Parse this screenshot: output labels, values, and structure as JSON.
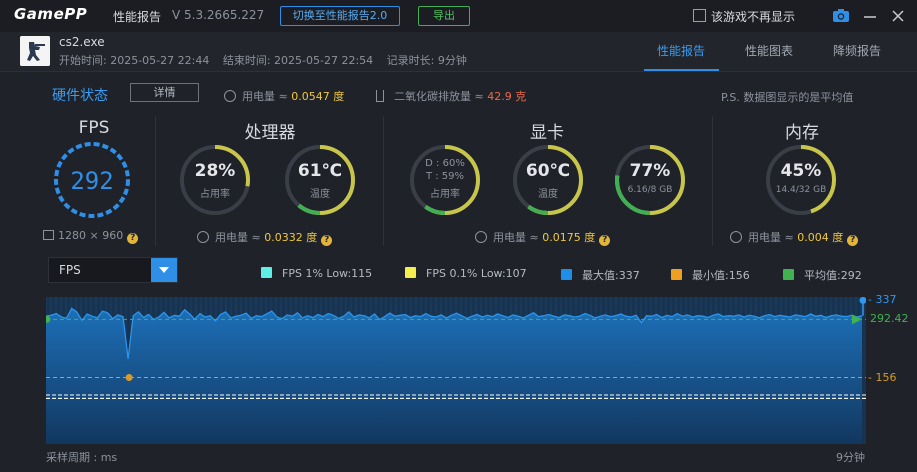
{
  "titlebar": {
    "logo": "GamePP",
    "title": "性能报告",
    "version": "V 5.3.2665.227",
    "switch_label": "切换至性能报告2.0",
    "export_label": "导出",
    "dont_show_label": "该游戏不再显示"
  },
  "header": {
    "game_name": "cs2.exe",
    "start_time": "开始时间: 2025-05-27 22:44",
    "end_time": "结束时间: 2025-05-27 22:54",
    "duration": "记录时长: 9分钟",
    "tabs": [
      {
        "label": "性能报告",
        "active": true
      },
      {
        "label": "性能图表",
        "active": false
      },
      {
        "label": "降频报告",
        "active": false
      }
    ]
  },
  "hardware": {
    "title": "硬件状态",
    "detail_label": "详情",
    "power_prefix": "用电量 ≈ ",
    "power_total": "0.0547 度",
    "co2_prefix": "二氧化碳排放量 ≈ ",
    "co2_value": "42.9 克",
    "ps_note": "P.S. 数据图显示的是平均值"
  },
  "sections": {
    "fps": {
      "title": "FPS",
      "value": "292",
      "resolution": "1280 × 960"
    },
    "cpu": {
      "title": "处理器",
      "usage": {
        "value": "28%",
        "label": "占用率",
        "fraction": 0.28
      },
      "temp": {
        "value": "61℃",
        "label": "温度",
        "fraction": 0.61
      },
      "power": "0.0332 度"
    },
    "gpu": {
      "title": "显卡",
      "usage": {
        "d": "D : 60%",
        "t": "T : 59%",
        "label": "占用率",
        "fraction": 0.6
      },
      "temp": {
        "value": "60℃",
        "label": "温度",
        "fraction": 0.6
      },
      "vram": {
        "value": "77%",
        "label": "6.16/8 GB",
        "fraction": 0.77
      },
      "power": "0.0175 度"
    },
    "memory": {
      "title": "内存",
      "usage": {
        "value": "45%",
        "label": "14.4/32 GB",
        "fraction": 0.45
      },
      "power": "0.004 度"
    }
  },
  "chart_controls": {
    "metric": "FPS",
    "legend": [
      {
        "label": "FPS 1% Low:115",
        "color": "#5ef0e6"
      },
      {
        "label": "FPS 0.1% Low:107",
        "color": "#f3ee4e"
      },
      {
        "label": "最大值:337",
        "color": "#1e8fe8"
      },
      {
        "label": "最小值:156",
        "color": "#f0a020"
      },
      {
        "label": "平均值:292",
        "color": "#3fb34f"
      }
    ],
    "x_left_label": "采样周期 : ms",
    "x_right_label": "9分钟"
  },
  "chart_data": {
    "type": "area",
    "series": [
      {
        "name": "FPS",
        "values": [
          300,
          302,
          306,
          298,
          295,
          318,
          310,
          290,
          305,
          300,
          296,
          312,
          308,
          294,
          303,
          299,
          200,
          301,
          310,
          297,
          304,
          292,
          298,
          309,
          296,
          302,
          300,
          315,
          305,
          293,
          306,
          298,
          301,
          289,
          304,
          310,
          296,
          300,
          302,
          307,
          295,
          301,
          299,
          305,
          312,
          298,
          294,
          303,
          300,
          308,
          296,
          301,
          297,
          304,
          299,
          306,
          302,
          295,
          300,
          310,
          298,
          303,
          301,
          296,
          305,
          292,
          299,
          307,
          300,
          302,
          304,
          297,
          301,
          299,
          306,
          300,
          298,
          303,
          296,
          302,
          307,
          301,
          295,
          300,
          304,
          298,
          302,
          299,
          305,
          301,
          297,
          303,
          300,
          296,
          302,
          308,
          299,
          301,
          304,
          300,
          297,
          303,
          301,
          298,
          300,
          306,
          302,
          296,
          300,
          303,
          299,
          301,
          305,
          300,
          298,
          302,
          285,
          301,
          300,
          304,
          297,
          302,
          299,
          306,
          300,
          303,
          298,
          301,
          300,
          297,
          302,
          305,
          299,
          301,
          300,
          303,
          298,
          302,
          300,
          296,
          301,
          304,
          299,
          302,
          300,
          298,
          303,
          301,
          299,
          305,
          300,
          302,
          297,
          301,
          303,
          300,
          299,
          302,
          298,
          301
        ]
      }
    ],
    "ylim": [
      0,
      345
    ],
    "reference_lines": {
      "max": 337,
      "min": 156,
      "avg": 292.42,
      "low_1pct": 115,
      "low_01pct": 107
    },
    "ref_labels": {
      "max": "337",
      "avg": "292.42",
      "min": "156"
    },
    "colors": {
      "fill_top": "#1d6fb8",
      "fill_bottom": "#12375f",
      "line": "#2896f0",
      "avg": "#3fb34f",
      "min": "#d79a28",
      "max": "#2e97f0",
      "low1": "#5ef0e6",
      "low01": "#f3ee4e"
    }
  }
}
